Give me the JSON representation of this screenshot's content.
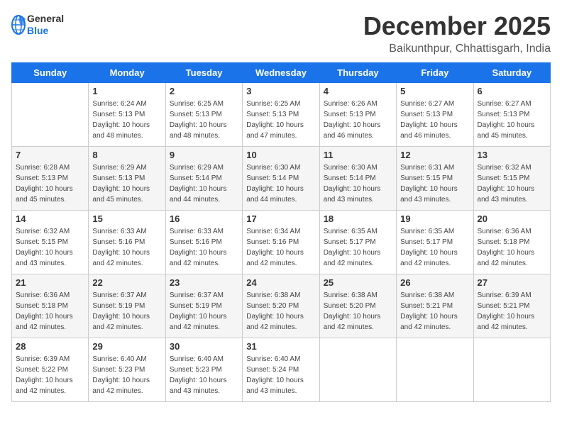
{
  "header": {
    "logo_general": "General",
    "logo_blue": "Blue",
    "title": "December 2025",
    "subtitle": "Baikunthpur, Chhattisgarh, India"
  },
  "calendar": {
    "weekdays": [
      "Sunday",
      "Monday",
      "Tuesday",
      "Wednesday",
      "Thursday",
      "Friday",
      "Saturday"
    ],
    "weeks": [
      [
        {
          "day": "",
          "sunrise": "",
          "sunset": "",
          "daylight": ""
        },
        {
          "day": "1",
          "sunrise": "Sunrise: 6:24 AM",
          "sunset": "Sunset: 5:13 PM",
          "daylight": "Daylight: 10 hours and 48 minutes."
        },
        {
          "day": "2",
          "sunrise": "Sunrise: 6:25 AM",
          "sunset": "Sunset: 5:13 PM",
          "daylight": "Daylight: 10 hours and 48 minutes."
        },
        {
          "day": "3",
          "sunrise": "Sunrise: 6:25 AM",
          "sunset": "Sunset: 5:13 PM",
          "daylight": "Daylight: 10 hours and 47 minutes."
        },
        {
          "day": "4",
          "sunrise": "Sunrise: 6:26 AM",
          "sunset": "Sunset: 5:13 PM",
          "daylight": "Daylight: 10 hours and 46 minutes."
        },
        {
          "day": "5",
          "sunrise": "Sunrise: 6:27 AM",
          "sunset": "Sunset: 5:13 PM",
          "daylight": "Daylight: 10 hours and 46 minutes."
        },
        {
          "day": "6",
          "sunrise": "Sunrise: 6:27 AM",
          "sunset": "Sunset: 5:13 PM",
          "daylight": "Daylight: 10 hours and 45 minutes."
        }
      ],
      [
        {
          "day": "7",
          "sunrise": "Sunrise: 6:28 AM",
          "sunset": "Sunset: 5:13 PM",
          "daylight": "Daylight: 10 hours and 45 minutes."
        },
        {
          "day": "8",
          "sunrise": "Sunrise: 6:29 AM",
          "sunset": "Sunset: 5:13 PM",
          "daylight": "Daylight: 10 hours and 45 minutes."
        },
        {
          "day": "9",
          "sunrise": "Sunrise: 6:29 AM",
          "sunset": "Sunset: 5:14 PM",
          "daylight": "Daylight: 10 hours and 44 minutes."
        },
        {
          "day": "10",
          "sunrise": "Sunrise: 6:30 AM",
          "sunset": "Sunset: 5:14 PM",
          "daylight": "Daylight: 10 hours and 44 minutes."
        },
        {
          "day": "11",
          "sunrise": "Sunrise: 6:30 AM",
          "sunset": "Sunset: 5:14 PM",
          "daylight": "Daylight: 10 hours and 43 minutes."
        },
        {
          "day": "12",
          "sunrise": "Sunrise: 6:31 AM",
          "sunset": "Sunset: 5:15 PM",
          "daylight": "Daylight: 10 hours and 43 minutes."
        },
        {
          "day": "13",
          "sunrise": "Sunrise: 6:32 AM",
          "sunset": "Sunset: 5:15 PM",
          "daylight": "Daylight: 10 hours and 43 minutes."
        }
      ],
      [
        {
          "day": "14",
          "sunrise": "Sunrise: 6:32 AM",
          "sunset": "Sunset: 5:15 PM",
          "daylight": "Daylight: 10 hours and 43 minutes."
        },
        {
          "day": "15",
          "sunrise": "Sunrise: 6:33 AM",
          "sunset": "Sunset: 5:16 PM",
          "daylight": "Daylight: 10 hours and 42 minutes."
        },
        {
          "day": "16",
          "sunrise": "Sunrise: 6:33 AM",
          "sunset": "Sunset: 5:16 PM",
          "daylight": "Daylight: 10 hours and 42 minutes."
        },
        {
          "day": "17",
          "sunrise": "Sunrise: 6:34 AM",
          "sunset": "Sunset: 5:16 PM",
          "daylight": "Daylight: 10 hours and 42 minutes."
        },
        {
          "day": "18",
          "sunrise": "Sunrise: 6:35 AM",
          "sunset": "Sunset: 5:17 PM",
          "daylight": "Daylight: 10 hours and 42 minutes."
        },
        {
          "day": "19",
          "sunrise": "Sunrise: 6:35 AM",
          "sunset": "Sunset: 5:17 PM",
          "daylight": "Daylight: 10 hours and 42 minutes."
        },
        {
          "day": "20",
          "sunrise": "Sunrise: 6:36 AM",
          "sunset": "Sunset: 5:18 PM",
          "daylight": "Daylight: 10 hours and 42 minutes."
        }
      ],
      [
        {
          "day": "21",
          "sunrise": "Sunrise: 6:36 AM",
          "sunset": "Sunset: 5:18 PM",
          "daylight": "Daylight: 10 hours and 42 minutes."
        },
        {
          "day": "22",
          "sunrise": "Sunrise: 6:37 AM",
          "sunset": "Sunset: 5:19 PM",
          "daylight": "Daylight: 10 hours and 42 minutes."
        },
        {
          "day": "23",
          "sunrise": "Sunrise: 6:37 AM",
          "sunset": "Sunset: 5:19 PM",
          "daylight": "Daylight: 10 hours and 42 minutes."
        },
        {
          "day": "24",
          "sunrise": "Sunrise: 6:38 AM",
          "sunset": "Sunset: 5:20 PM",
          "daylight": "Daylight: 10 hours and 42 minutes."
        },
        {
          "day": "25",
          "sunrise": "Sunrise: 6:38 AM",
          "sunset": "Sunset: 5:20 PM",
          "daylight": "Daylight: 10 hours and 42 minutes."
        },
        {
          "day": "26",
          "sunrise": "Sunrise: 6:38 AM",
          "sunset": "Sunset: 5:21 PM",
          "daylight": "Daylight: 10 hours and 42 minutes."
        },
        {
          "day": "27",
          "sunrise": "Sunrise: 6:39 AM",
          "sunset": "Sunset: 5:21 PM",
          "daylight": "Daylight: 10 hours and 42 minutes."
        }
      ],
      [
        {
          "day": "28",
          "sunrise": "Sunrise: 6:39 AM",
          "sunset": "Sunset: 5:22 PM",
          "daylight": "Daylight: 10 hours and 42 minutes."
        },
        {
          "day": "29",
          "sunrise": "Sunrise: 6:40 AM",
          "sunset": "Sunset: 5:23 PM",
          "daylight": "Daylight: 10 hours and 42 minutes."
        },
        {
          "day": "30",
          "sunrise": "Sunrise: 6:40 AM",
          "sunset": "Sunset: 5:23 PM",
          "daylight": "Daylight: 10 hours and 43 minutes."
        },
        {
          "day": "31",
          "sunrise": "Sunrise: 6:40 AM",
          "sunset": "Sunset: 5:24 PM",
          "daylight": "Daylight: 10 hours and 43 minutes."
        },
        {
          "day": "",
          "sunrise": "",
          "sunset": "",
          "daylight": ""
        },
        {
          "day": "",
          "sunrise": "",
          "sunset": "",
          "daylight": ""
        },
        {
          "day": "",
          "sunrise": "",
          "sunset": "",
          "daylight": ""
        }
      ]
    ]
  }
}
